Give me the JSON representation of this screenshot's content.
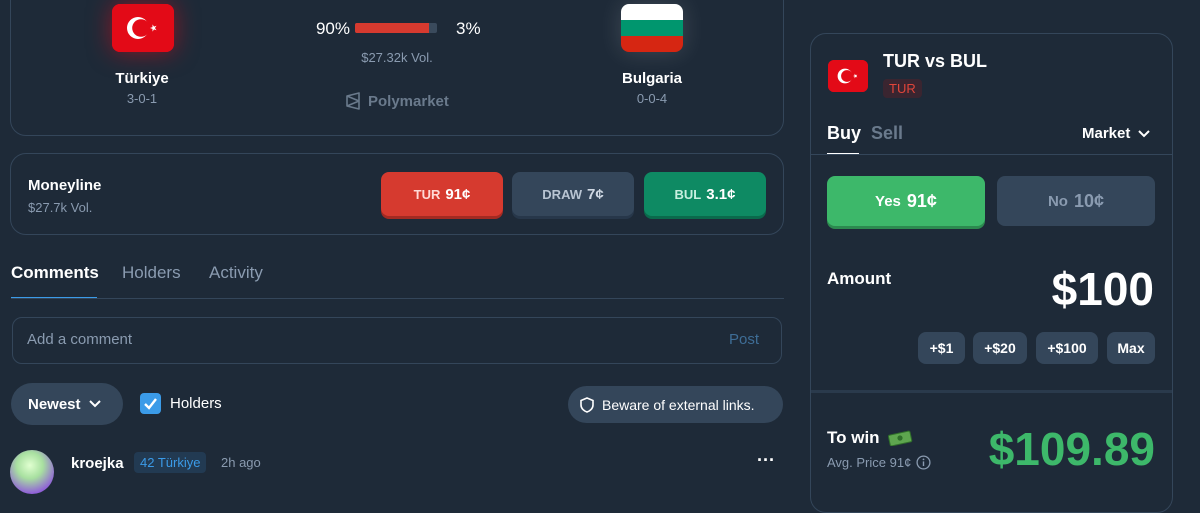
{
  "match": {
    "team1": {
      "name": "Türkiye",
      "record": "3-0-1"
    },
    "team2": {
      "name": "Bulgaria",
      "record": "0-0-4"
    },
    "left_pct": "90%",
    "right_pct": "3%",
    "left_share": 0.9,
    "right_share": 0.03,
    "volume": "$27.32k Vol.",
    "source": "Polymarket"
  },
  "moneyline": {
    "title": "Moneyline",
    "volume": "$27.7k Vol.",
    "options": [
      {
        "label": "TUR",
        "price": "91¢",
        "color": "#d63a2f"
      },
      {
        "label": "DRAW",
        "price": "7¢",
        "color": "#34465a"
      },
      {
        "label": "BUL",
        "price": "3.1¢",
        "color": "#0e8a63"
      }
    ]
  },
  "tabs": [
    "Comments",
    "Holders",
    "Activity"
  ],
  "comment_box": {
    "placeholder": "Add a comment",
    "post": "Post"
  },
  "filters": {
    "sort": "Newest",
    "holders": "Holders",
    "warning": "Beware of external links."
  },
  "comment": {
    "user": "kroejka",
    "badge": "42 Türkiye",
    "time": "2h ago",
    "more": "···"
  },
  "trade": {
    "title": "TUR vs BUL",
    "tag": "TUR",
    "buy": "Buy",
    "sell": "Sell",
    "order_type": "Market",
    "yes": {
      "label": "Yes",
      "price": "91¢"
    },
    "no": {
      "label": "No",
      "price": "10¢"
    },
    "amount_label": "Amount",
    "amount": "$100",
    "quick": [
      "+$1",
      "+$20",
      "+$100",
      "Max"
    ],
    "to_win": "To win",
    "avg_price": "Avg. Price 91¢",
    "payout": "$109.89"
  },
  "colors": {
    "background": "#1e2a38",
    "border": "#34465a",
    "accent_blue": "#3b9be8",
    "yes_green": "#3db86a",
    "payout_green": "#3db86a",
    "red": "#d63a2f"
  }
}
